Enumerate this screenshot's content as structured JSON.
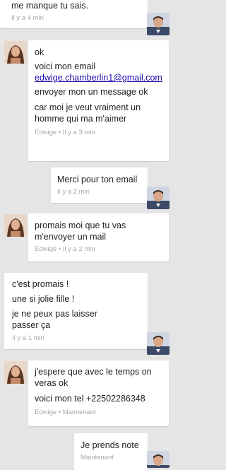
{
  "messages": [
    {
      "sender": "me",
      "lines": [
        "me manque tu sais."
      ],
      "meta": "Il y a 4 min"
    },
    {
      "sender": "Edwige",
      "lines": [
        "ok",
        "voici mon email",
        "edwige.chamberlin1@gmail.com",
        "envoyer mon un message ok",
        "car moi je veut vraiment un homme qui ma m'aimer"
      ],
      "meta": "Edwige • Il y a 3 min"
    },
    {
      "sender": "me",
      "lines": [
        "Merci pour ton email"
      ],
      "meta": "Il y a 2 min"
    },
    {
      "sender": "Edwige",
      "lines": [
        "promais moi que tu vas m'envoyer un mail"
      ],
      "meta": "Edwige • Il y a 2 min"
    },
    {
      "sender": "me",
      "lines": [
        "c'est promais !",
        "une si jolie fille !",
        "je ne peux pas laisser passer ça"
      ],
      "meta": "Il y a 1 min"
    },
    {
      "sender": "Edwige",
      "lines": [
        "j'espere que  avec le temps on veras ok",
        "voici mon tel +22502286348"
      ],
      "meta": "Edwige • Maintenant"
    },
    {
      "sender": "me",
      "lines": [
        "Je prends note"
      ],
      "meta": "Maintenant"
    }
  ],
  "colors": {
    "background": "#e5e5e5",
    "bubble": "#ffffff",
    "meta_text": "#a7a7a7",
    "link": "#1a0dab"
  }
}
